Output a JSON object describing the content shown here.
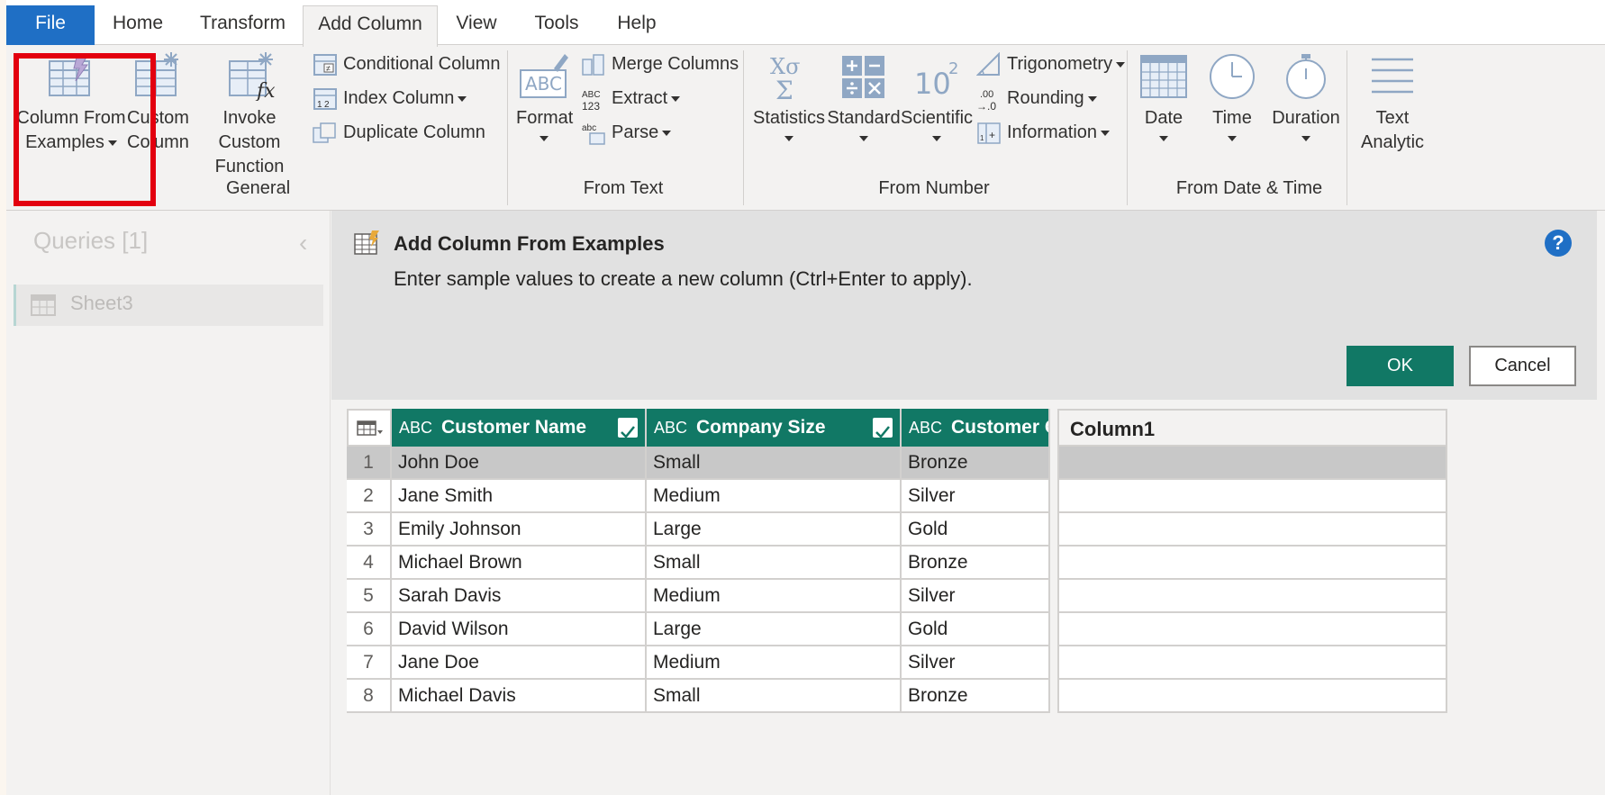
{
  "tabs": [
    "File",
    "Home",
    "Transform",
    "Add Column",
    "View",
    "Tools",
    "Help"
  ],
  "ribbon": {
    "general": {
      "column_from_examples": [
        "Column From",
        "Examples"
      ],
      "custom_column": [
        "Custom",
        "Column"
      ],
      "invoke_custom_function": [
        "Invoke Custom",
        "Function"
      ],
      "conditional_column": "Conditional Column",
      "index_column": "Index Column",
      "duplicate_column": "Duplicate Column",
      "label": "General"
    },
    "from_text": {
      "format": "Format",
      "merge_columns": "Merge Columns",
      "extract": "Extract",
      "parse": "Parse",
      "label": "From Text"
    },
    "from_number": {
      "statistics": "Statistics",
      "standard": "Standard",
      "scientific": "Scientific",
      "trigonometry": "Trigonometry",
      "rounding": "Rounding",
      "information": "Information",
      "label": "From Number"
    },
    "from_date_time": {
      "date": "Date",
      "time": "Time",
      "duration": "Duration",
      "label": "From Date & Time"
    },
    "text_analytics": [
      "Text",
      "Analytic"
    ]
  },
  "queries": {
    "title": "Queries [1]",
    "items": [
      "Sheet3"
    ]
  },
  "panel": {
    "title": "Add Column From Examples",
    "description": "Enter sample values to create a new column (Ctrl+Enter to apply).",
    "ok": "OK",
    "cancel": "Cancel"
  },
  "table": {
    "type_label": "ABC",
    "columns": [
      "Customer Name",
      "Company Size",
      "Customer Gro"
    ],
    "new_column": "Column1",
    "rows": [
      {
        "idx": "1",
        "name": "John Doe",
        "size": "Small",
        "group": "Bronze"
      },
      {
        "idx": "2",
        "name": "Jane Smith",
        "size": "Medium",
        "group": "Silver"
      },
      {
        "idx": "3",
        "name": "Emily Johnson",
        "size": "Large",
        "group": "Gold"
      },
      {
        "idx": "4",
        "name": "Michael Brown",
        "size": "Small",
        "group": "Bronze"
      },
      {
        "idx": "5",
        "name": "Sarah Davis",
        "size": "Medium",
        "group": "Silver"
      },
      {
        "idx": "6",
        "name": "David Wilson",
        "size": "Large",
        "group": "Gold"
      },
      {
        "idx": "7",
        "name": "Jane Doe",
        "size": "Medium",
        "group": "Silver"
      },
      {
        "idx": "8",
        "name": "Michael Davis",
        "size": "Small",
        "group": "Bronze"
      }
    ]
  },
  "colors": {
    "accent_green": "#117865",
    "file_blue": "#1f6fc5",
    "highlight_red": "#e3000f"
  }
}
